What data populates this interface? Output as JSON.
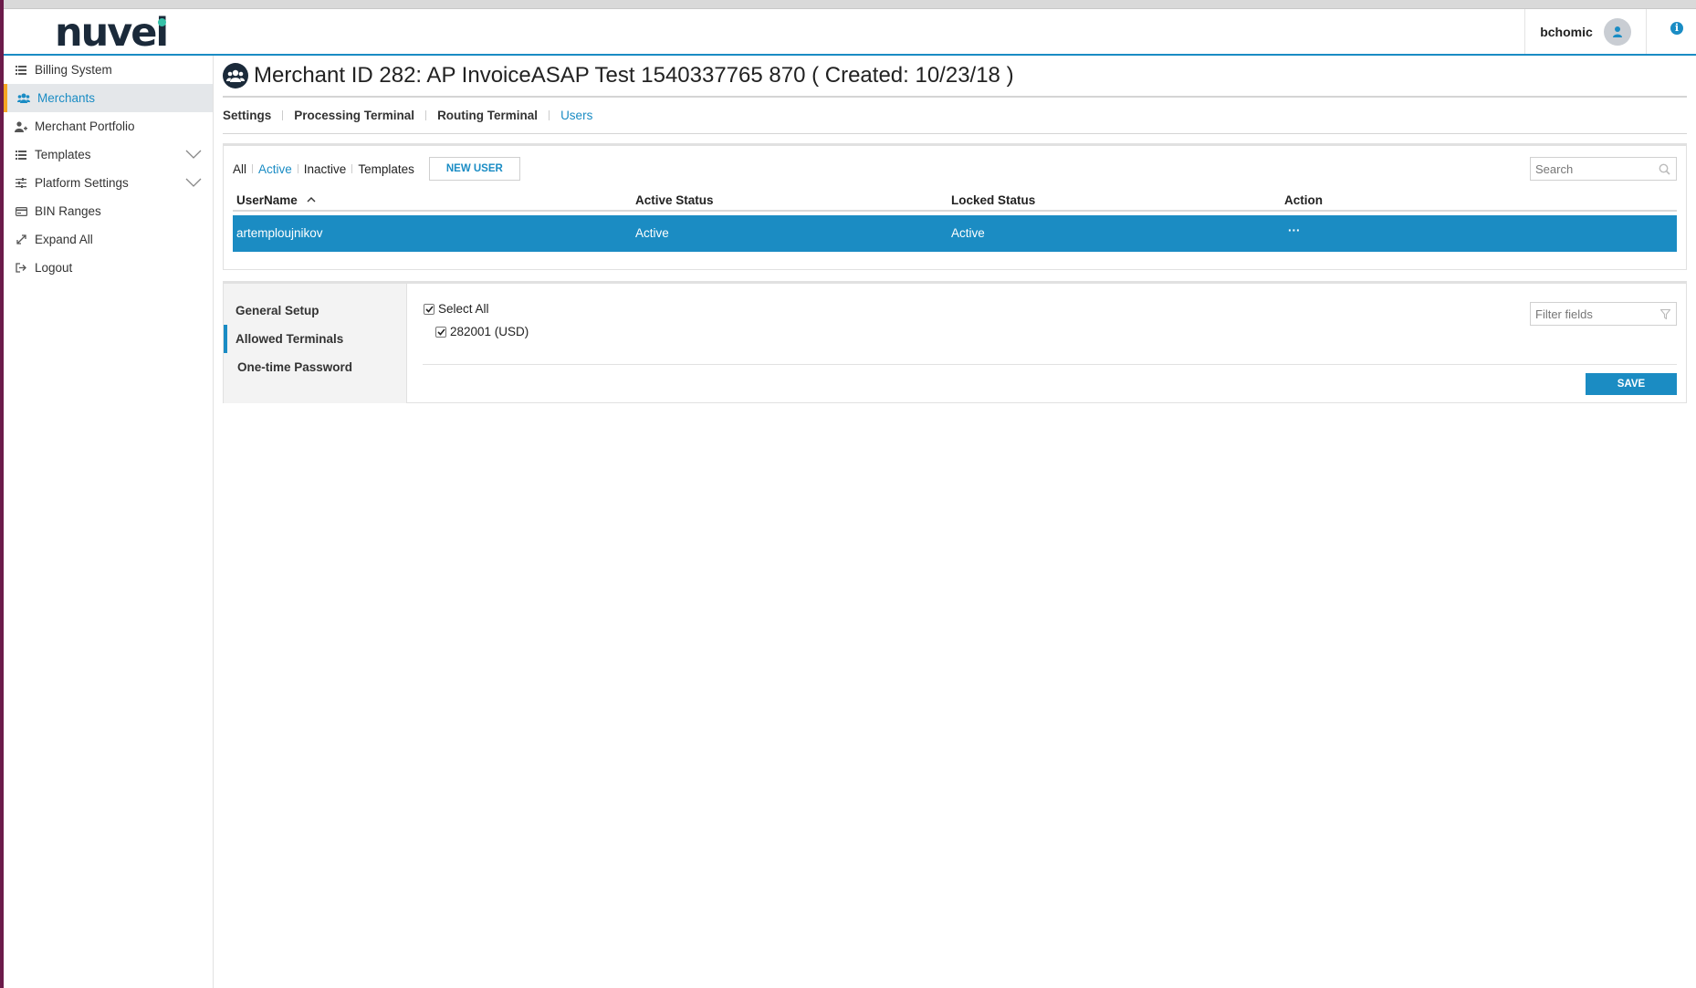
{
  "header": {
    "logo_text": "nuvei",
    "username": "bchomic",
    "user_icon": "user-icon",
    "info_icon": "info-icon"
  },
  "sidebar": {
    "items": [
      {
        "label": "Billing System",
        "icon": "list-icon"
      },
      {
        "label": "Merchants",
        "icon": "users-icon",
        "active": true
      },
      {
        "label": "Merchant Portfolio",
        "icon": "user-plus-icon"
      },
      {
        "label": "Templates",
        "icon": "list-icon",
        "expandable": true
      },
      {
        "label": "Platform Settings",
        "icon": "sliders-icon",
        "expandable": true
      },
      {
        "label": "BIN Ranges",
        "icon": "credit-card-icon"
      },
      {
        "label": "Expand All",
        "icon": "expand-icon"
      },
      {
        "label": "Logout",
        "icon": "logout-icon"
      }
    ]
  },
  "page": {
    "title": "Merchant ID 282: AP InvoiceASAP Test 1540337765 870 ( Created: 10/23/18 )",
    "title_icon": "merchants-group-icon"
  },
  "tabs": [
    {
      "label": "Settings"
    },
    {
      "label": "Processing Terminal"
    },
    {
      "label": "Routing Terminal"
    },
    {
      "label": "Users",
      "active": true
    }
  ],
  "users_panel": {
    "filters": [
      {
        "label": "All"
      },
      {
        "label": "Active",
        "active": true
      },
      {
        "label": "Inactive"
      },
      {
        "label": "Templates"
      }
    ],
    "new_user_label": "NEW USER",
    "search_placeholder": "Search",
    "columns": {
      "username": "UserName",
      "active_status": "Active Status",
      "locked_status": "Locked Status",
      "action": "Action"
    },
    "sort_indicator": "ascending",
    "rows": [
      {
        "username": "artemploujnikov",
        "active_status": "Active",
        "locked_status": "Active",
        "action": "···"
      }
    ]
  },
  "user_detail": {
    "nav": [
      {
        "label": "General Setup"
      },
      {
        "label": "Allowed Terminals",
        "active": true
      },
      {
        "label": "One-time Password"
      }
    ],
    "select_all_label": "Select All",
    "terminals": [
      {
        "label": "282001 (USD)",
        "checked": true
      }
    ],
    "filter_placeholder": "Filter fields",
    "save_label": "SAVE"
  },
  "colors": {
    "accent": "#1a8cc4",
    "sidebar_active_marker": "#f5a623",
    "selected_row": "#1b8cc3",
    "logo_dark": "#1b2a3a",
    "logo_dot": "#36c1a8"
  }
}
